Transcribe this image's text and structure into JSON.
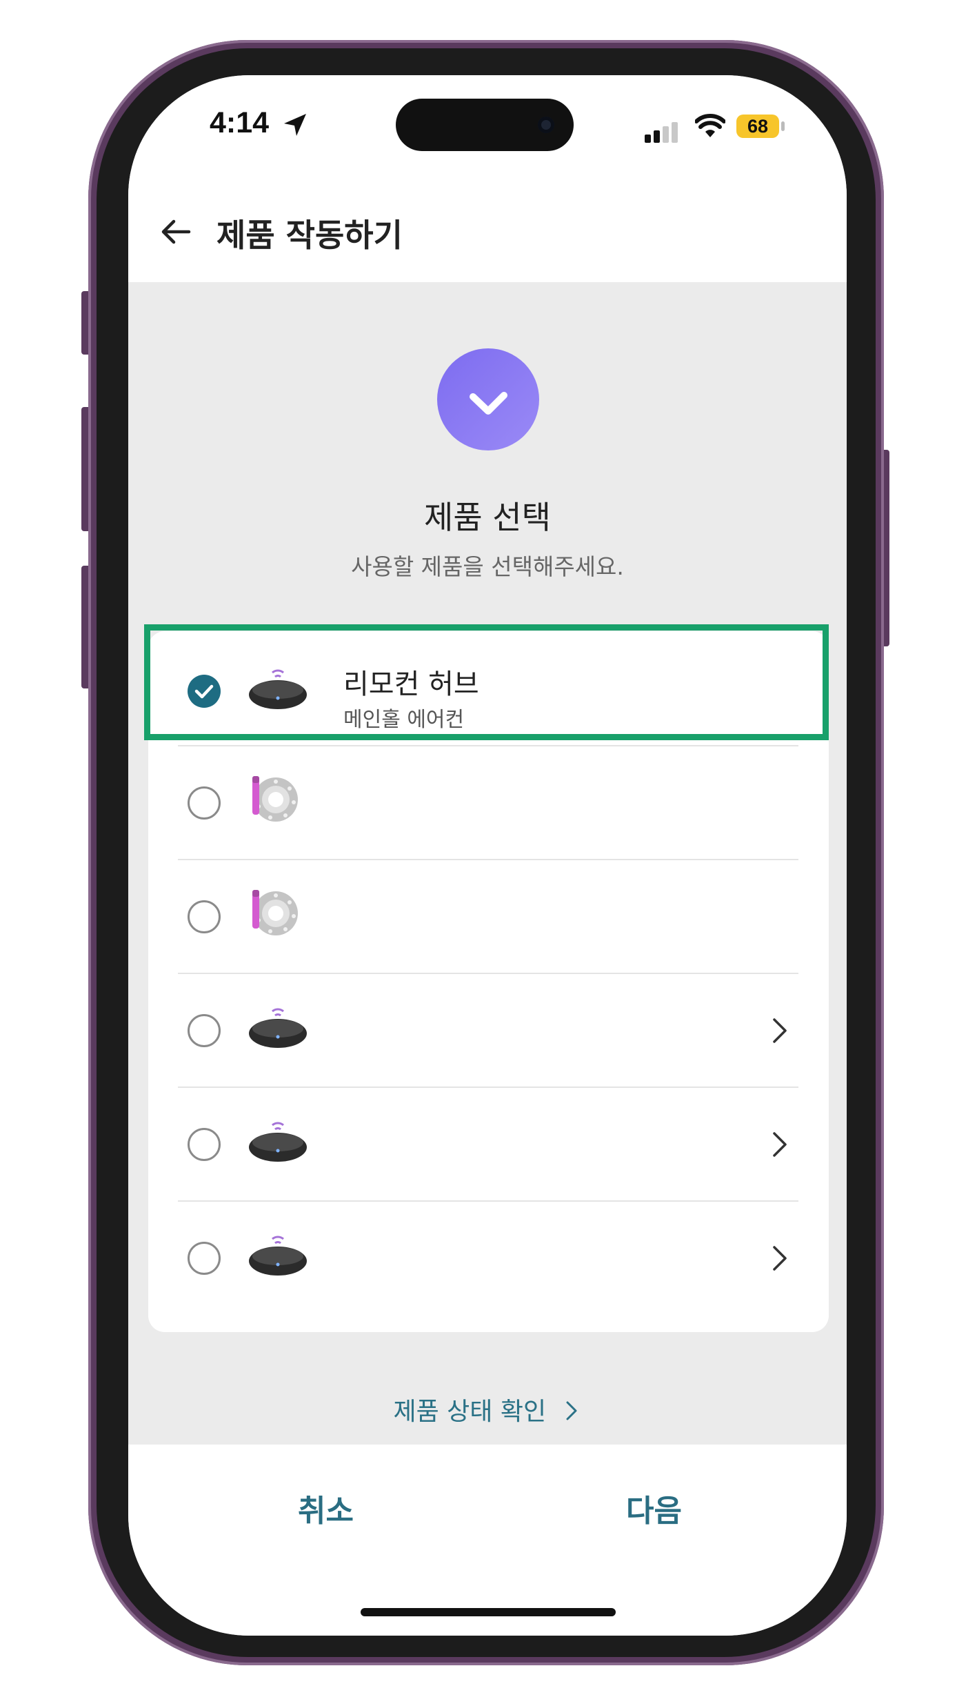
{
  "status_bar": {
    "time": "4:14",
    "battery": "68"
  },
  "header": {
    "title": "제품 작동하기"
  },
  "section": {
    "title": "제품 선택",
    "subtitle": "사용할 제품을 선택해주세요."
  },
  "products": [
    {
      "title": "리모컨 허브",
      "subtitle": "메인홀 에어컨",
      "selected": true,
      "icon": "remote-hub-icon",
      "has_chevron": false
    },
    {
      "title": "",
      "subtitle": "",
      "selected": false,
      "icon": "led-strip-icon",
      "has_chevron": false
    },
    {
      "title": "",
      "subtitle": "",
      "selected": false,
      "icon": "led-strip-icon",
      "has_chevron": false
    },
    {
      "title": "",
      "subtitle": "",
      "selected": false,
      "icon": "remote-hub-icon",
      "has_chevron": true
    },
    {
      "title": "",
      "subtitle": "",
      "selected": false,
      "icon": "remote-hub-icon",
      "has_chevron": true
    },
    {
      "title": "",
      "subtitle": "",
      "selected": false,
      "icon": "remote-hub-icon",
      "has_chevron": true
    }
  ],
  "links": {
    "check_status": "제품 상태 확인"
  },
  "footer": {
    "cancel": "취소",
    "next": "다음"
  },
  "colors": {
    "accent": "#1e6c82",
    "highlight": "#18a06a",
    "check_circle": "#8a7af3"
  }
}
